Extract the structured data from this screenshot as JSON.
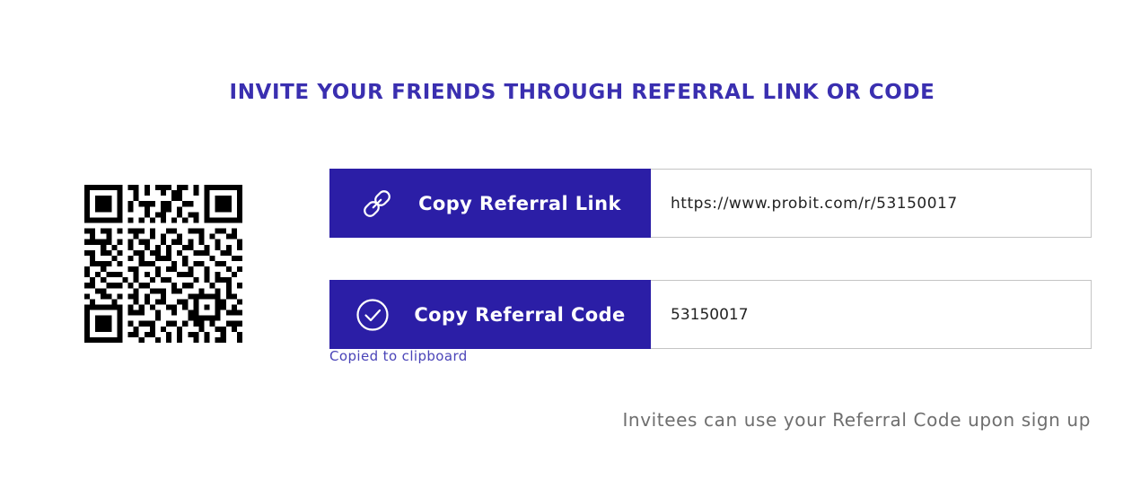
{
  "page": {
    "title": "INVITE YOUR FRIENDS THROUGH REFERRAL LINK OR CODE",
    "hint": "Invitees can use your Referral Code upon sign up"
  },
  "referral_link": {
    "button_label": "Copy Referral Link",
    "icon": "link-icon",
    "value": "https://www.probit.com/r/53150017"
  },
  "referral_code": {
    "button_label": "Copy Referral Code",
    "icon": "check-circle-icon",
    "value": "53150017",
    "status": "Copied to clipboard"
  },
  "qr": {
    "icon": "qr-code"
  },
  "colors": {
    "accent": "#2b1ea6",
    "title": "#3a2fb0",
    "status": "#4a44b8",
    "hint": "#6e6e6e"
  }
}
